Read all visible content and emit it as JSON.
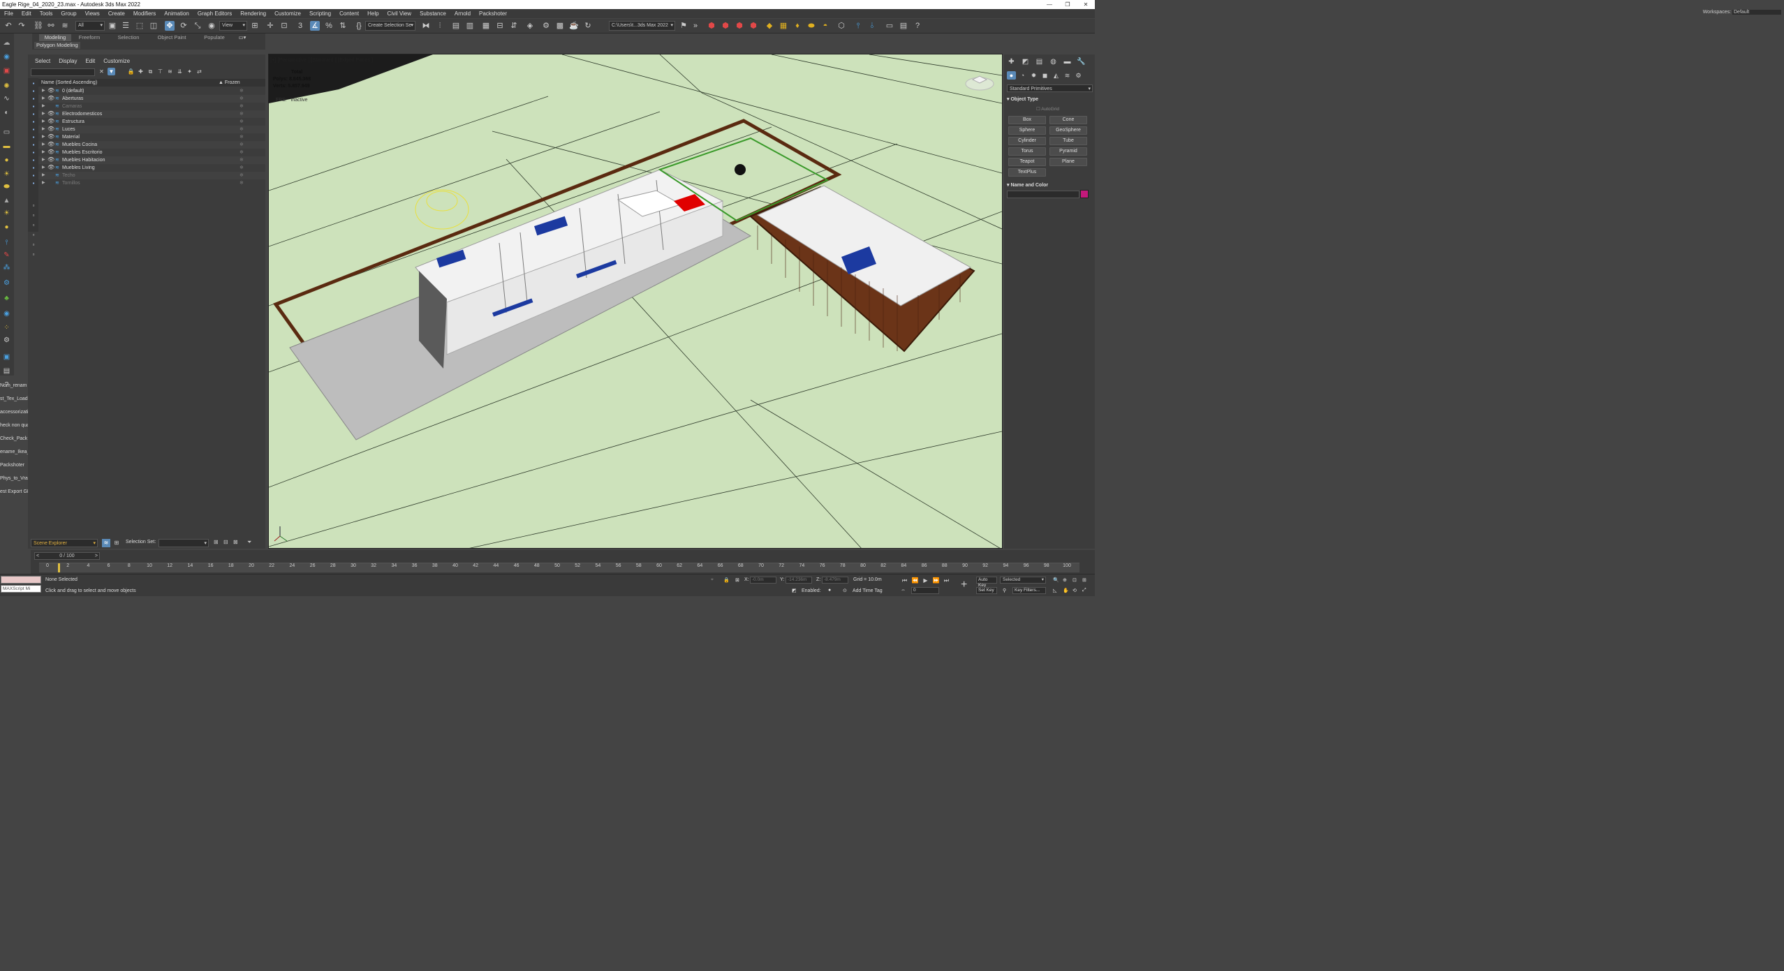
{
  "window": {
    "title": "Eagle Rige_04_2020_23.max - Autodesk 3ds Max 2022",
    "controls": [
      "—",
      "❐",
      "✕"
    ]
  },
  "menu": [
    "File",
    "Edit",
    "Tools",
    "Group",
    "Views",
    "Create",
    "Modifiers",
    "Animation",
    "Graph Editors",
    "Rendering",
    "Customize",
    "Scripting",
    "Content",
    "Help",
    "Civil View",
    "Substance",
    "Arnold",
    "Packshoter"
  ],
  "workspace": {
    "label": "Workspaces:",
    "value": "Default"
  },
  "toolbar": {
    "filter": "All",
    "coord_system": "View",
    "selection_set": "Create Selection Se",
    "project_path": "C:\\Users\\t...3ds Max 2022"
  },
  "ribbon": {
    "tabs": [
      "Modeling",
      "Freeform",
      "Selection",
      "Object Paint",
      "Populate"
    ],
    "active_tab": "Modeling",
    "panel": "Polygon Modeling"
  },
  "scripts": [
    "Nom_renam",
    "st_Tex_Loade",
    "accessorizatio",
    "heck non qua",
    "Check_Pack",
    "ename_Ikea_",
    "Packshoter",
    "Phys_to_Vray",
    "est Export GL"
  ],
  "scene_explorer": {
    "menu": [
      "Select",
      "Display",
      "Edit",
      "Customize"
    ],
    "col_name": "Name (Sorted Ascending)",
    "col_frozen": "▲ Frozen",
    "layers": [
      {
        "name": "0 (default)",
        "dim": false
      },
      {
        "name": "Aberturas",
        "dim": false
      },
      {
        "name": "Camaras",
        "dim": true
      },
      {
        "name": "Electrodomesticos",
        "dim": false
      },
      {
        "name": "Estructura",
        "dim": false
      },
      {
        "name": "Luces",
        "dim": false
      },
      {
        "name": "Material",
        "dim": false
      },
      {
        "name": "Muebles Cocina",
        "dim": false
      },
      {
        "name": "Muebles Escritorio",
        "dim": false
      },
      {
        "name": "Muebles Habitacion",
        "dim": false
      },
      {
        "name": "Muebles Living",
        "dim": false
      },
      {
        "name": "Techo",
        "dim": true
      },
      {
        "name": "Tornillos",
        "dim": true
      }
    ],
    "footer_name": "Scene Explorer",
    "selection_set_label": "Selection Set:"
  },
  "viewport": {
    "label": "[+] [Perspective ] [Standard ] [Edged Faces ]",
    "stats": {
      "total_label": "Total",
      "polys_label": "Polys:",
      "polys": "8.845.368",
      "verts_label": "Verts:",
      "verts": "5.857.949"
    },
    "fps_label": "FPS:",
    "fps_value": "Inactive"
  },
  "command_panel": {
    "category": "Standard Primitives",
    "object_type_title": "Object Type",
    "autogrid": "AutoGrid",
    "buttons": [
      "Box",
      "Cone",
      "Sphere",
      "GeoSphere",
      "Cylinder",
      "Tube",
      "Torus",
      "Pyramid",
      "Teapot",
      "Plane",
      "TextPlus"
    ],
    "name_color_title": "Name and Color",
    "object_color": "#c3197b"
  },
  "timeline": {
    "slider": "0 / 100",
    "ticks": [
      "0",
      "2",
      "4",
      "6",
      "8",
      "10",
      "12",
      "14",
      "16",
      "18",
      "20",
      "22",
      "24",
      "26",
      "28",
      "30",
      "32",
      "34",
      "36",
      "38",
      "40",
      "42",
      "44",
      "46",
      "48",
      "50",
      "52",
      "54",
      "56",
      "58",
      "60",
      "62",
      "64",
      "66",
      "68",
      "70",
      "72",
      "74",
      "76",
      "78",
      "80",
      "82",
      "84",
      "86",
      "88",
      "90",
      "92",
      "94",
      "96",
      "98",
      "100"
    ]
  },
  "status": {
    "maxscript_placeholder": "MAXScript Mi",
    "selection": "None Selected",
    "prompt": "Click and drag to select and move objects",
    "x_label": "X:",
    "x_value": "-0.0m",
    "y_label": "Y:",
    "y_value": "-14.236m",
    "z_label": "Z:",
    "z_value": "-8.479m",
    "grid": "Grid = 10.0m",
    "enabled_label": "Enabled:",
    "add_time_tag": "Add Time Tag",
    "auto_key": "Auto Key",
    "set_key": "Set Key",
    "key_mode": "Selected",
    "key_filters": "Key Filters...",
    "frame": "0"
  }
}
